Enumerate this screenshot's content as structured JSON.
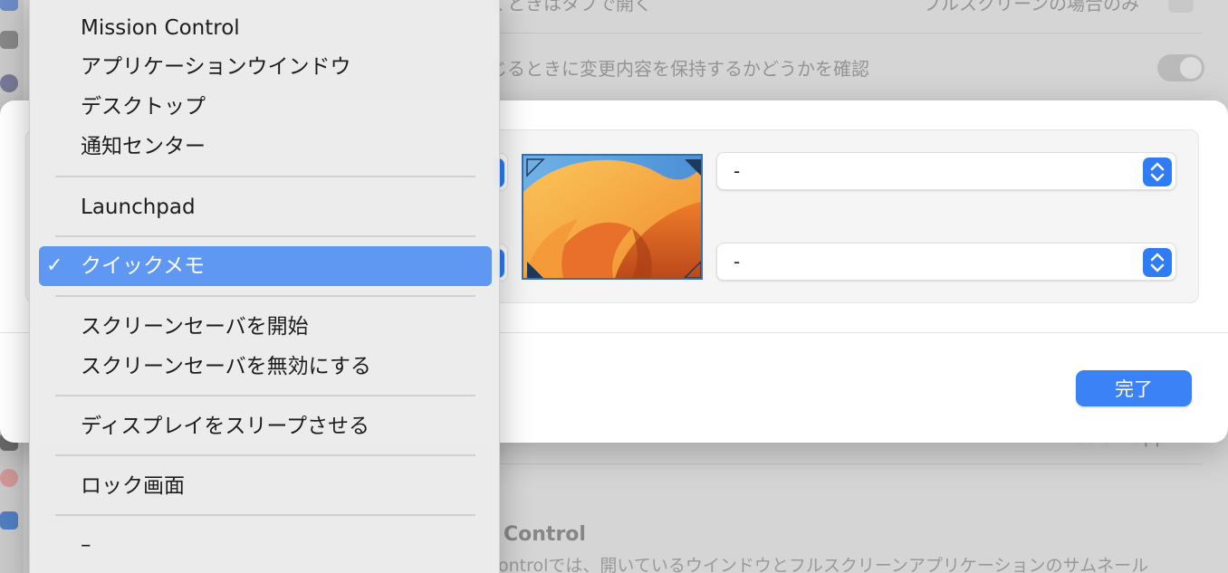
{
  "background": {
    "rows": [
      {
        "text": "くときはタブで開く",
        "value": "フルスクリーンの場合のみ"
      },
      {
        "text": "じるときに変更内容を保持するかどうかを確認"
      }
    ],
    "lower_row_value": "Safari.app",
    "section_heading": "Control",
    "section_desc": "ontrolでは、開いているウインドウとフルスクリーンアプリケーションのサムネール"
  },
  "sheet": {
    "top_right_value": "-",
    "bottom_right_value": "-",
    "done_label": "完了"
  },
  "menu": {
    "items": [
      {
        "label": "Mission Control"
      },
      {
        "label": "アプリケーションウインドウ"
      },
      {
        "label": "デスクトップ"
      },
      {
        "label": "通知センター"
      },
      {
        "label": "Launchpad"
      },
      {
        "label": "クイックメモ",
        "selected": true
      },
      {
        "label": "スクリーンセーバを開始"
      },
      {
        "label": "スクリーンセーバを無効にする"
      },
      {
        "label": "ディスプレイをスリープさせる"
      },
      {
        "label": "ロック画面"
      },
      {
        "label": "–"
      }
    ],
    "check_glyph": "✓"
  },
  "colors": {
    "accent": "#3b82f6",
    "menu_highlight": "#5f98f3"
  }
}
